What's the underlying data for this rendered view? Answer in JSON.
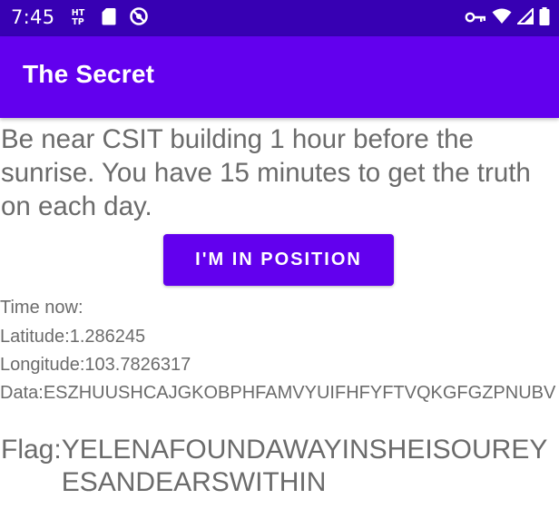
{
  "status_bar": {
    "time": "7:45",
    "bg_color": "#3700b3",
    "left_icons": [
      "http-icon",
      "sd-card-icon",
      "no-location-icon"
    ],
    "right_icons": [
      "vpn-key-icon",
      "wifi-icon",
      "signal-icon",
      "battery-icon"
    ]
  },
  "app_bar": {
    "title": "The Secret",
    "bg_color": "#6200ee"
  },
  "main": {
    "instructions": "Be near CSIT building 1 hour before the sunrise. You have 15 minutes to get the truth on each day.",
    "position_button_label": "I'M IN POSITION",
    "time_now_label": "Time now:",
    "time_now_value": "",
    "latitude_label": "Latitude:",
    "latitude_value": "1.286245",
    "longitude_label": "Longitude:",
    "longitude_value": "103.7826317",
    "data_label": "Data:",
    "data_value": "ESZHUUSHCAJGKOBPHFAMVYUIFHFYFTVQKGFGZPNUBV",
    "flag_label": "Flag:",
    "flag_value": "YELENAFOUNDAWAYINSHEISOUREYESANDEARSWITHIN"
  }
}
